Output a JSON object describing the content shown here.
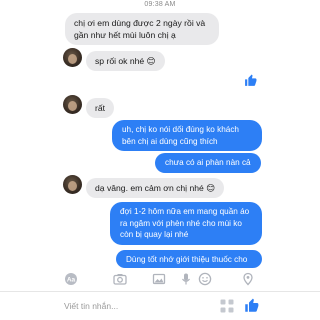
{
  "status": {
    "time": "09:38 AM"
  },
  "messages": [
    {
      "side": "in",
      "text": "chị ơi em dùng được 2 ngày rồi và gần như hết mùi luôn chị ạ"
    },
    {
      "side": "in",
      "text": "sp rối ok nhé 😊"
    },
    {
      "side": "out",
      "type": "like-icon"
    },
    {
      "side": "in",
      "text": "rất"
    },
    {
      "side": "out",
      "text": "uh, chị ko nói dối đúng ko khách bên chị ai dùng cũng thích"
    },
    {
      "side": "out",
      "text": "chưa có ai phàn nàn cả"
    },
    {
      "side": "in",
      "text": "dạ vâng. em cảm ơn chị nhé 😊"
    },
    {
      "side": "out",
      "text": "đợi 1-2 hôm nữa em mang quần áo ra ngâm với phèn nhé cho mùi ko còn bị quay lại nhé"
    },
    {
      "side": "out",
      "text": "Dùng tốt nhớ giới thiệu thuốc cho"
    }
  ],
  "composer": {
    "placeholder": "Viết tin nhắn...",
    "toolbar_icons": [
      "text-style-icon",
      "camera-icon",
      "image-icon",
      "microphone-icon",
      "emoji-icon",
      "location-icon"
    ],
    "accent_color": "#2d7ff5"
  }
}
